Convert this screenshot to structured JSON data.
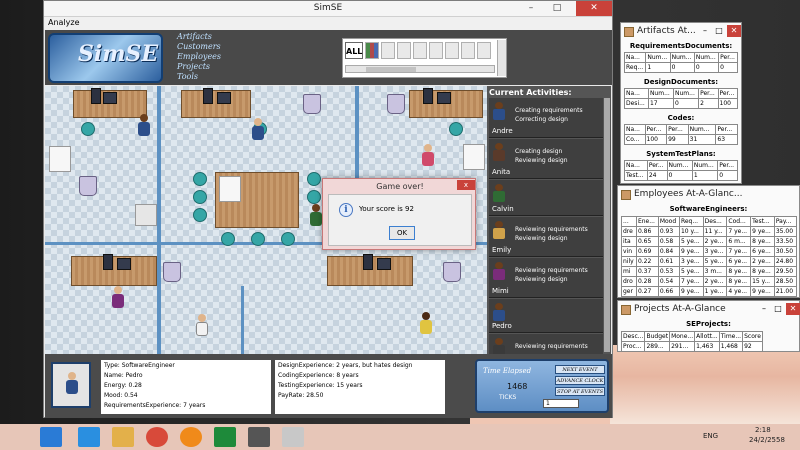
{
  "main_window": {
    "title": "SimSE",
    "menu": [
      "Analyze"
    ],
    "logo_text": "SimSE",
    "nav": [
      "Artifacts",
      "Customers",
      "Employees",
      "Projects",
      "Tools"
    ],
    "artifact_filter": "ALL"
  },
  "activities": {
    "title": "Current Activities:",
    "rows": [
      {
        "name": "Andre",
        "lines": [
          "Creating requirements",
          "Correcting design"
        ],
        "color": "#2c4e8a"
      },
      {
        "name": "Anita",
        "lines": [
          "Creating design",
          "Reviewing design"
        ],
        "color": "#5a3a2a"
      },
      {
        "name": "Calvin",
        "lines": [],
        "color": "#2f6b34"
      },
      {
        "name": "Emily",
        "lines": [
          "Reviewing requirements",
          "Reviewing design"
        ],
        "color": "#d0a24a"
      },
      {
        "name": "Mimi",
        "lines": [
          "Reviewing requirements",
          "Reviewing design"
        ],
        "color": "#7a2c7a"
      },
      {
        "name": "Pedro",
        "lines": [],
        "color": "#2c4e8a"
      },
      {
        "name": "Roger",
        "lines": [
          "Reviewing requirements"
        ],
        "color": "#3a3a3a"
      }
    ]
  },
  "dialog": {
    "title": "Game over!",
    "message": "Your score is 92",
    "ok_label": "OK",
    "close_label": "x",
    "icon": "i"
  },
  "employee_info": {
    "col1": [
      "Type: SoftwareEngineer",
      "Name: Pedro",
      "Energy: 0.28",
      "Mood: 0.54",
      "RequirementsExperience: 7 years"
    ],
    "col2": [
      "DesignExperience: 2 years, but hates design",
      "CodingExperience: 8 years",
      "TestingExperience: 15 years",
      "PayRate: 28.50"
    ]
  },
  "time_panel": {
    "title": "Time Elapsed",
    "value": "1468",
    "ticks_label": "TICKS",
    "ticks_input": "1",
    "buttons": [
      "NEXT EVENT",
      "ADVANCE CLOCK",
      "STOP AT EVENTS"
    ]
  },
  "artifacts_window": {
    "title": "Artifacts At...",
    "sections": [
      {
        "label": "RequirementsDocuments:",
        "headers": [
          "Na...",
          "Num...",
          "Num...",
          "Num...",
          "Per..."
        ],
        "row": [
          "Req...",
          "1",
          "0",
          "0",
          "0"
        ]
      },
      {
        "label": "DesignDocuments:",
        "headers": [
          "Na...",
          "Num...",
          "Num...",
          "Per...",
          "Per..."
        ],
        "row": [
          "Desi...",
          "17",
          "0",
          "2",
          "100"
        ]
      },
      {
        "label": "Codes:",
        "headers": [
          "Na...",
          "Per...",
          "Per...",
          "Num...",
          "Per..."
        ],
        "row": [
          "Co...",
          "100",
          "99",
          "31",
          "63"
        ]
      },
      {
        "label": "SystemTestPlans:",
        "headers": [
          "Na...",
          "Per...",
          "Num...",
          "Num...",
          "Per..."
        ],
        "row": [
          "Test...",
          "24",
          "0",
          "1",
          "0"
        ]
      }
    ]
  },
  "employees_window": {
    "title": "Employees At-A-Glanc...",
    "label": "SoftwareEngineers:",
    "headers": [
      "...",
      "Ene...",
      "Mood",
      "Req...",
      "Des...",
      "Cod...",
      "Test...",
      "Pay..."
    ],
    "rows": [
      [
        "dre",
        "0.86",
        "0.93",
        "10 y...",
        "11 y...",
        "7 ye...",
        "9 ye...",
        "35.00"
      ],
      [
        "ita",
        "0.65",
        "0.58",
        "5 ye...",
        "2 ye...",
        "6 m...",
        "8 ye...",
        "33.50"
      ],
      [
        "vin",
        "0.69",
        "0.84",
        "9 ye...",
        "3 ye...",
        "7 ye...",
        "6 ye...",
        "30.50"
      ],
      [
        "nily",
        "0.22",
        "0.61",
        "3 ye...",
        "5 ye...",
        "6 ye...",
        "2 ye...",
        "24.80"
      ],
      [
        "mi",
        "0.37",
        "0.53",
        "5 ye...",
        "3 m...",
        "8 ye...",
        "8 ye...",
        "29.50"
      ],
      [
        "dro",
        "0.28",
        "0.54",
        "7 ye...",
        "2 ye...",
        "8 ye...",
        "15 y...",
        "28.50"
      ],
      [
        "ger",
        "0.27",
        "0.66",
        "9 ye...",
        "1 ye...",
        "4 ye...",
        "9 ye...",
        "21.00"
      ]
    ]
  },
  "projects_window": {
    "title": "Projects At-A-Glance",
    "label": "SEProjects:",
    "headers": [
      "Desc...",
      "Budget",
      "Mone...",
      "Allott...",
      "Time...",
      "Score"
    ],
    "row": [
      "Proc...",
      "289...",
      "291...",
      "1,463",
      "1,468",
      "92"
    ]
  },
  "taskbar": {
    "lang": "ENG",
    "time": "2:18",
    "date": "24/2/2558"
  }
}
